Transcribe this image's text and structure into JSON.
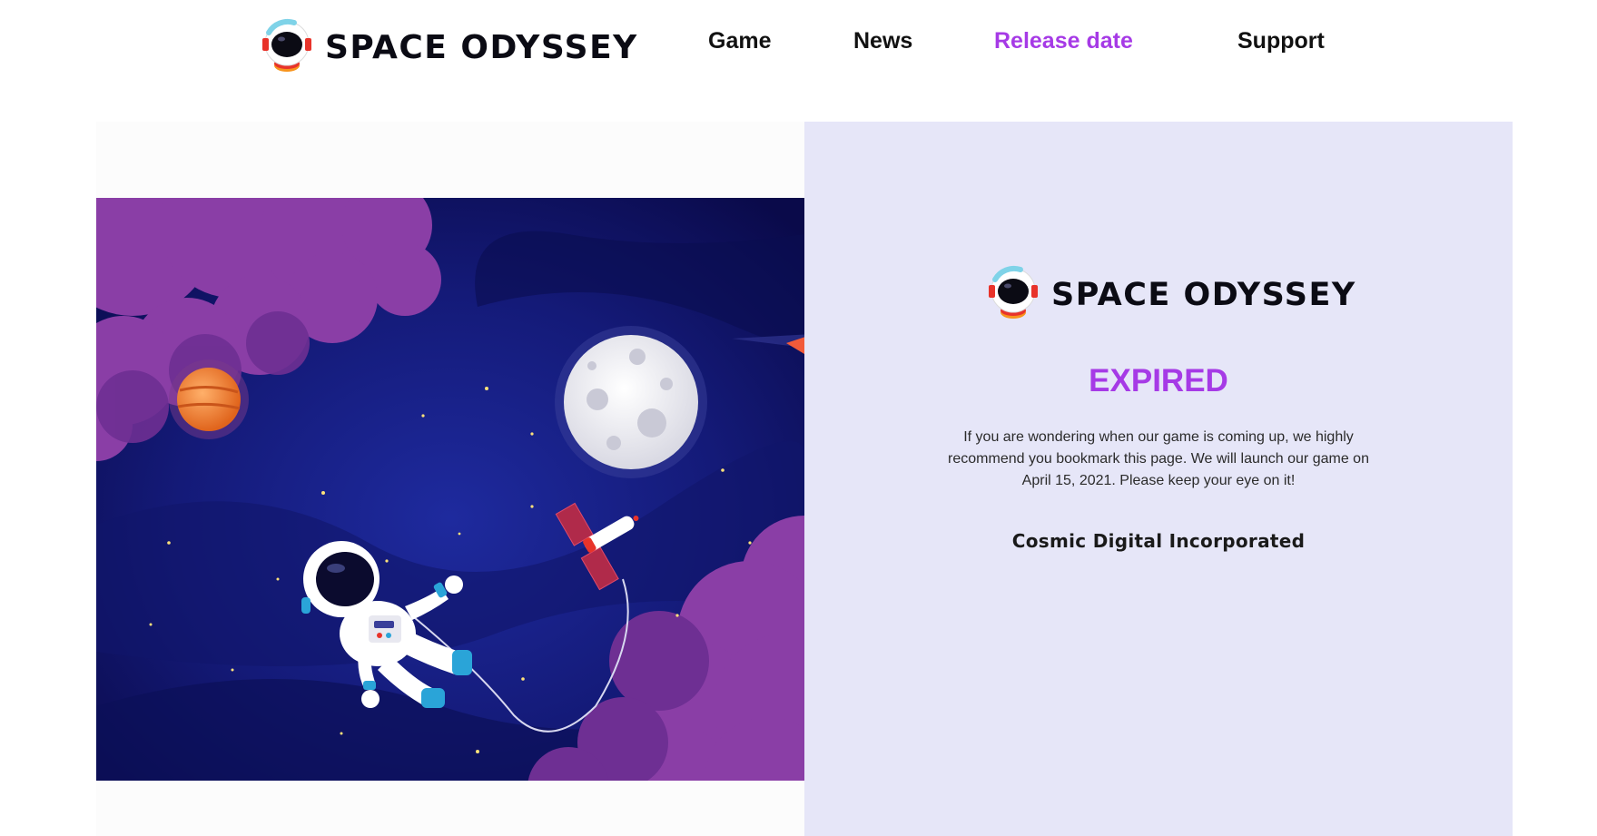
{
  "header": {
    "brand_name": "SPACE ODYSSEY",
    "brand_icon": "astronaut-helmet-icon",
    "nav": [
      {
        "label": "Game",
        "active": false
      },
      {
        "label": "News",
        "active": false
      },
      {
        "label": "Release date",
        "active": true
      },
      {
        "label": "Support",
        "active": false
      }
    ]
  },
  "hero": {
    "illustration": "astronaut-floating-in-space-illustration"
  },
  "card": {
    "brand_name": "SPACE ODYSSEY",
    "status": "EXPIRED",
    "description": "If you are wondering when our game is coming up, we highly recommend you bookmark this page. We will launch our game on April 15, 2021. Please keep your eye on it!",
    "company": "Cosmic Digital Incorporated"
  },
  "colors": {
    "accent": "#a63ae6",
    "card_background": "#e6e6f8",
    "space_dark": "#0a0a4a",
    "nebula_purple": "#8a3ea6"
  }
}
